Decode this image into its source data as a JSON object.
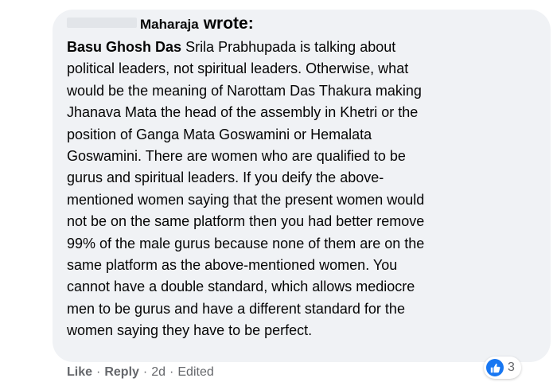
{
  "comment": {
    "header": {
      "quoted_name": "Maharaja",
      "wrote_label": "wrote:"
    },
    "author": "Basu Ghosh Das",
    "lines": [
      "Srila Prabhupada is talking about",
      "political leaders, not spiritual leaders. Otherwise, what",
      "would be the meaning of Narottam Das Thakura making",
      "Jhanava Mata the head of the assembly in Khetri or the",
      "position of Ganga Mata Goswamini or Hemalata",
      "Goswamini. There are women who are qualified to be",
      "gurus and spiritual leaders. If you deify the above-",
      "mentioned women saying that the present women would",
      "not be on the same platform then you had better remove",
      "99% of the male gurus because none of them are on the",
      "same platform as the above-mentioned women. You",
      "cannot have a double standard, which allows mediocre",
      "men to be gurus and have a different standard for the",
      "women saying they have to be perfect."
    ],
    "reactions": {
      "icon": "like-icon",
      "count": "3",
      "accent_color": "#1877f2"
    }
  },
  "actions": {
    "like_label": "Like",
    "reply_label": "Reply",
    "separator": "·",
    "timestamp": "2d",
    "edited_label": "Edited"
  }
}
